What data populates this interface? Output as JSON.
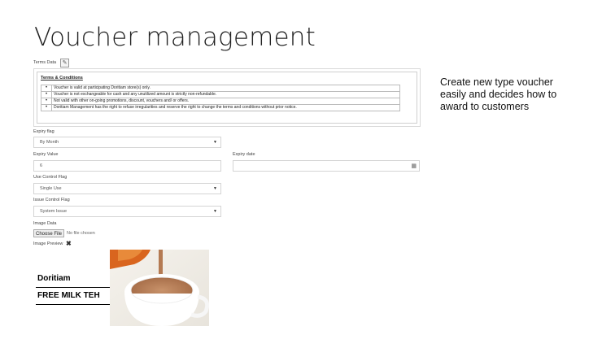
{
  "slide": {
    "title": "Voucher management",
    "note": "Create new type voucher easily and decides how to award to customers"
  },
  "form": {
    "terms_label": "Terms Data",
    "terms_heading": "Terms & Conditions",
    "terms": [
      "Voucher is valid at participating Doritiam store(s) only.",
      "Voucher is not exchangeable for cash and any unutilized amount is strictly non-refundable.",
      "Not valid with other on-going promotions, discount, vouchers and/ or offers.",
      "Doritiam Management has the right to refuse irregularities and reserve the right to change the terms and conditions without prior notice."
    ],
    "expiry_flag_label": "Expiry flag",
    "expiry_flag_value": "By Month",
    "expiry_value_label": "Expiry Value",
    "expiry_value": "6",
    "expiry_date_label": "Expiry date",
    "expiry_date_value": "",
    "use_control_label": "Use Control Flag",
    "use_control_value": "Single Use",
    "issue_control_label": "Issue Control Flag",
    "issue_control_value": "System Issue",
    "image_data_label": "Image Data",
    "choose_file_label": "Choose File",
    "file_status": "No file chosen",
    "image_preview_label": "Image Preview",
    "preview": {
      "brand": "Doritiam",
      "offer": "FREE MILK TEH"
    }
  },
  "icons": {
    "edit": "edit-icon",
    "dropdown": "caret-down-icon",
    "calendar": "calendar-icon",
    "remove": "close-icon"
  }
}
